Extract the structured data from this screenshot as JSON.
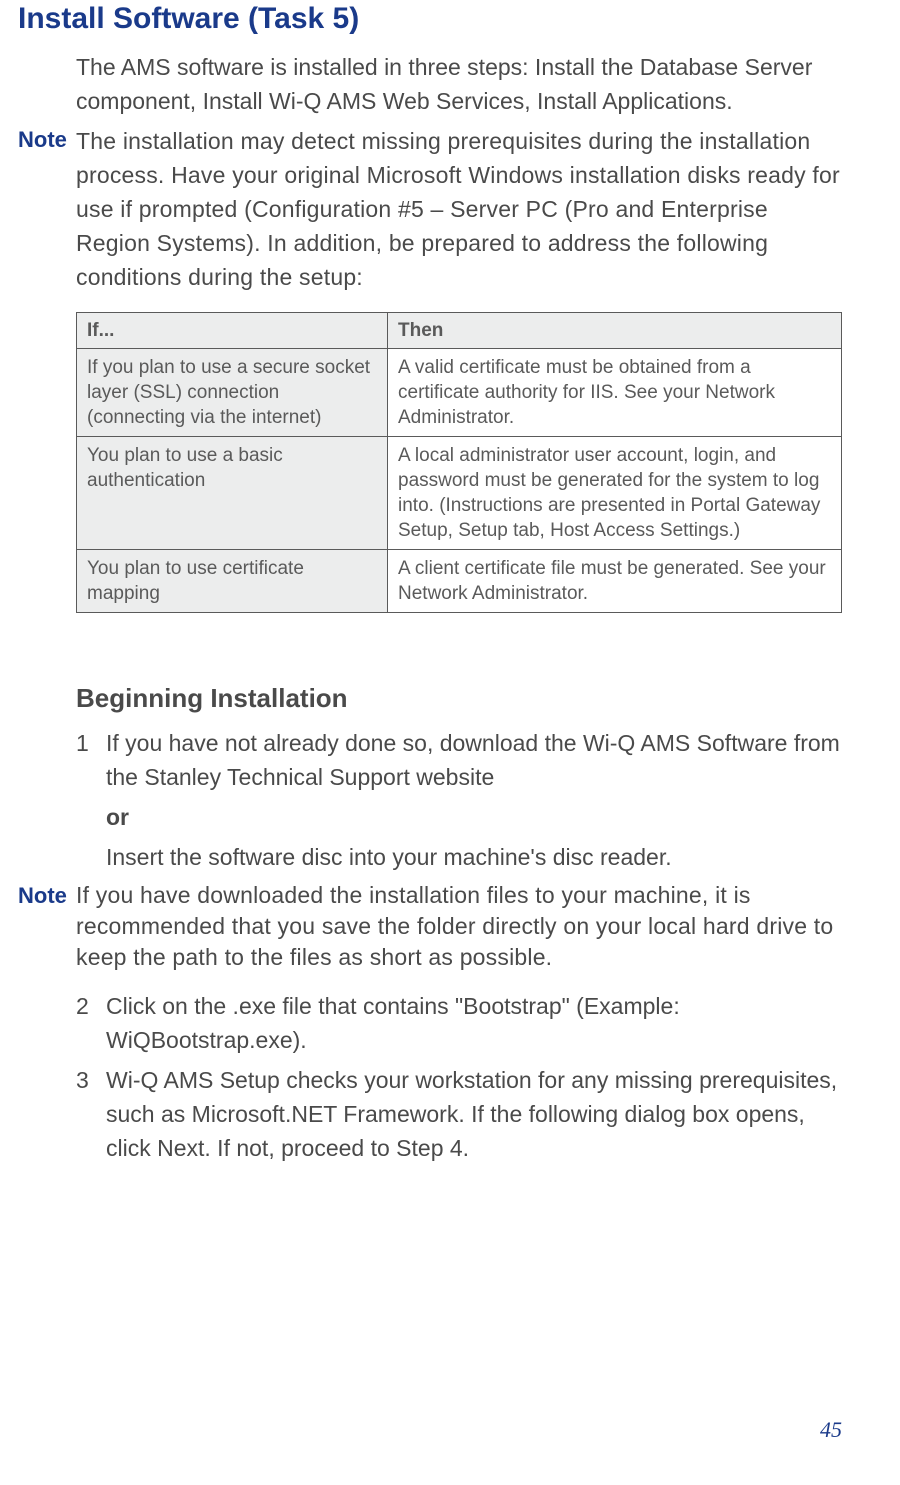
{
  "title": "Install Software (Task 5)",
  "intro": "The AMS software is installed in three steps: Install the Database Server component, Install Wi-Q AMS Web Services, Install Applications.",
  "note1_label": "Note",
  "note1_text": "The installation may detect missing prerequisites during the installation process. Have your original Microsoft Windows installation disks ready for use if prompted (Configuration #5 – Server PC (Pro and Enterprise Region Systems). In addition, be prepared to address the following conditions during the setup:",
  "table": {
    "headers": {
      "if": "If...",
      "then": "Then"
    },
    "rows": [
      {
        "if": "If you plan to use a secure socket layer (SSL) connection (connecting via the internet)",
        "then": "A valid certificate must be obtained from a certificate authority for IIS. See your Network Administrator."
      },
      {
        "if": "You plan to use a basic authentication",
        "then": "A local administrator user account, login, and password must be generated for the system to log into. (Instructions are presented in Portal Gateway Setup, Setup tab, Host Access Settings.)"
      },
      {
        "if": "You plan to use certificate mapping",
        "then": "A client certificate file must be generated. See your Network Administrator."
      }
    ]
  },
  "h2": "Beginning Installation",
  "steps": {
    "s1_num": "1",
    "s1_text": "If you have not already done so, download the Wi-Q AMS Software from the Stanley Technical Support website",
    "s1_or": "or",
    "s1_alt": "Insert the software disc into your machine's disc reader.",
    "note2_label": "Note",
    "note2_text": "If you have downloaded the installation files to your machine, it is recommended that you save the folder directly on your local hard drive to keep the path to the files as short as possible.",
    "s2_num": "2",
    "s2_text": "Click on the .exe file that contains \"Bootstrap\" (Example: WiQBootstrap.exe).",
    "s3_num": "3",
    "s3_text": "Wi-Q AMS Setup checks your workstation for any missing prerequisites, such as Microsoft.NET Framework. If the following dialog box opens, click Next. If not, proceed to Step 4."
  },
  "page_number": "45"
}
